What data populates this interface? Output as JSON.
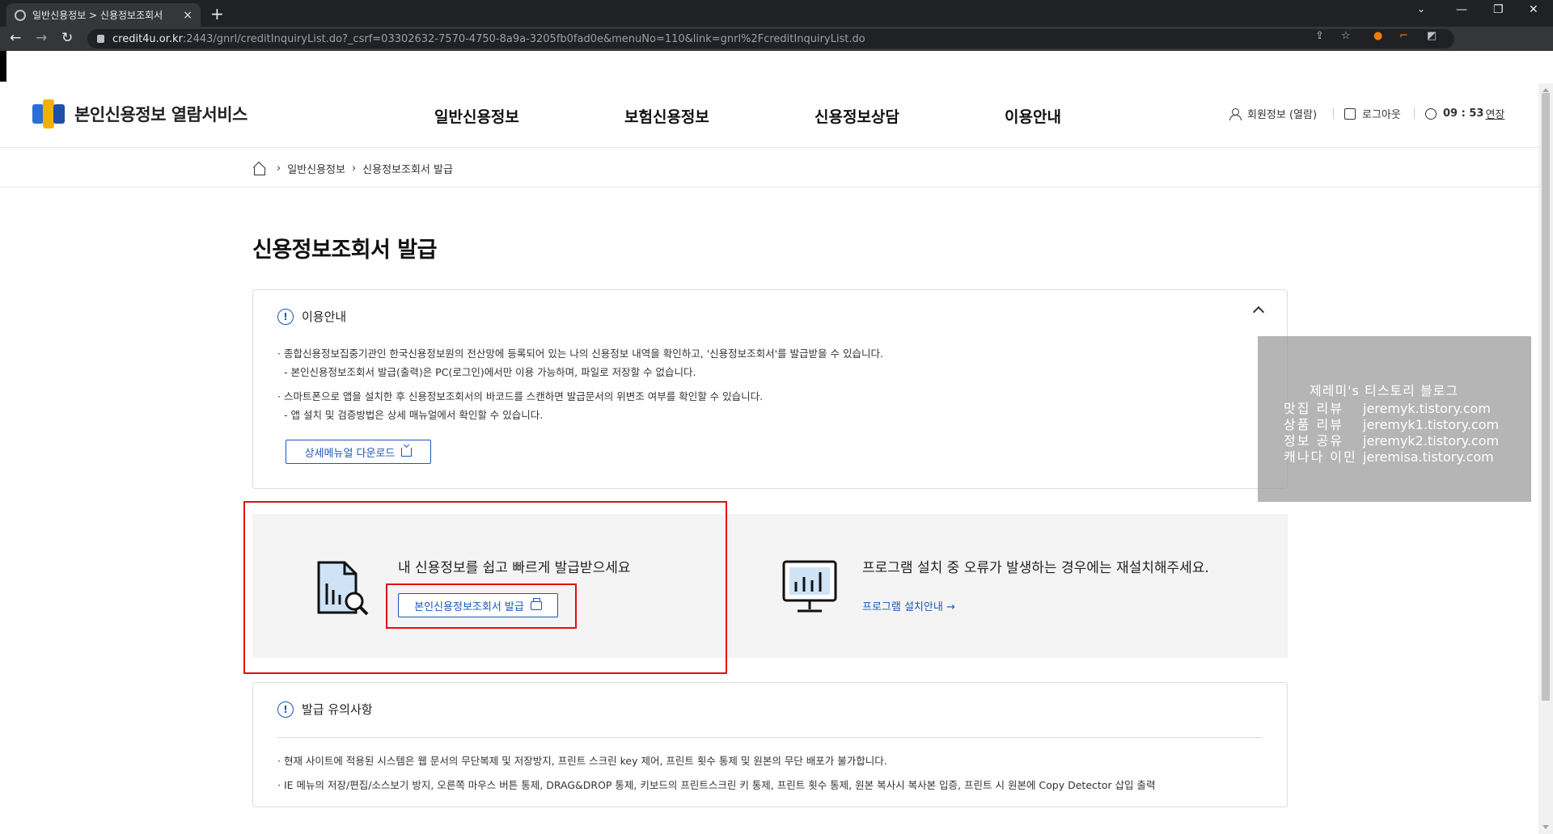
{
  "browser": {
    "tab_title": "일반신용정보 > 신용정보조회서",
    "url_host": "credit4u.or.kr",
    "url_rest": ":2443/gnrl/creditInquiryList.do?_csrf=03302632-7570-4750-8a9a-3205fb0fad0e&menuNo=110&link=gnrl%2FcreditInquiryList.do",
    "new_tab": "+",
    "close_tab": "×"
  },
  "header": {
    "logo_text": "본인신용정보 열람서비스",
    "nav": [
      "일반신용정보",
      "보험신용정보",
      "신용정보상담",
      "이용안내"
    ],
    "member_info": "회원정보 (열람)",
    "logout": "로그아웃",
    "timer": "09 : 53",
    "extend": "연장"
  },
  "breadcrumb": {
    "level1": "일반신용정보",
    "level2": "신용정보조회서 발급"
  },
  "main": {
    "title": "신용정보조회서 발급",
    "guide": {
      "heading": "이용안내",
      "line1": "종합신용정보집중기관인 한국신용정보원의 전산망에 등록되어 있는 나의 신용정보 내역을 확인하고, '신용정보조회서'를 발급받을 수 있습니다.",
      "line1_sub": "- 본인신용정보조회서 발급(출력)은 PC(로그인)에서만 이용 가능하며, 파일로 저장할 수 없습니다.",
      "line2": "스마트폰으로 앱을 설치한 후 신용정보조회서의 바코드를 스캔하면 발급문서의 위변조 여부를 확인할 수 있습니다.",
      "line2_sub": "- 앱 설치 및 검증방법은 상세 매뉴얼에서 확인할 수 있습니다.",
      "manual_button": "상세메뉴얼 다운로드"
    },
    "issue_panel": {
      "text": "내 신용정보를 쉽고 빠르게 발급받으세요",
      "button": "본인신용정보조회서 발급"
    },
    "install_panel": {
      "text": "프로그램 설치 중 오류가 발생하는 경우에는 재설치해주세요.",
      "link": "프로그램 설치안내 →"
    },
    "notice": {
      "heading": "발급 유의사항",
      "line1": "현재 사이트에 적용된 시스템은 웹 문서의 무단복제 및 저장방지, 프린트 스크린 key 제어, 프린트 횟수 통제 및 원본의 무단 배포가 불가합니다.",
      "line2": "IE 메뉴의 저장/편집/소스보기 방지, 오른쪽 마우스 버튼 통제, DRAG&DROP 통제, 키보드의 프린트스크린 키 통제, 프린트 횟수 통제, 원본 복사시 복사본 입증, 프린트 시 원본에 Copy Detector 삽입 출력"
    }
  },
  "watermark": {
    "title": "제레미's 티스토리 블로그",
    "rows": [
      {
        "k": "맛집 리뷰",
        "v": "jeremyk.tistory.com"
      },
      {
        "k": "상품 리뷰",
        "v": "jeremyk1.tistory.com"
      },
      {
        "k": "정보 공유",
        "v": "jeremyk2.tistory.com"
      },
      {
        "k": "캐나다 이민",
        "v": "jeremisa.tistory.com"
      }
    ]
  },
  "colors": {
    "brand_blue": "#1a56b8",
    "highlight_red": "#e01010",
    "panel_bg": "#f4f4f4"
  }
}
